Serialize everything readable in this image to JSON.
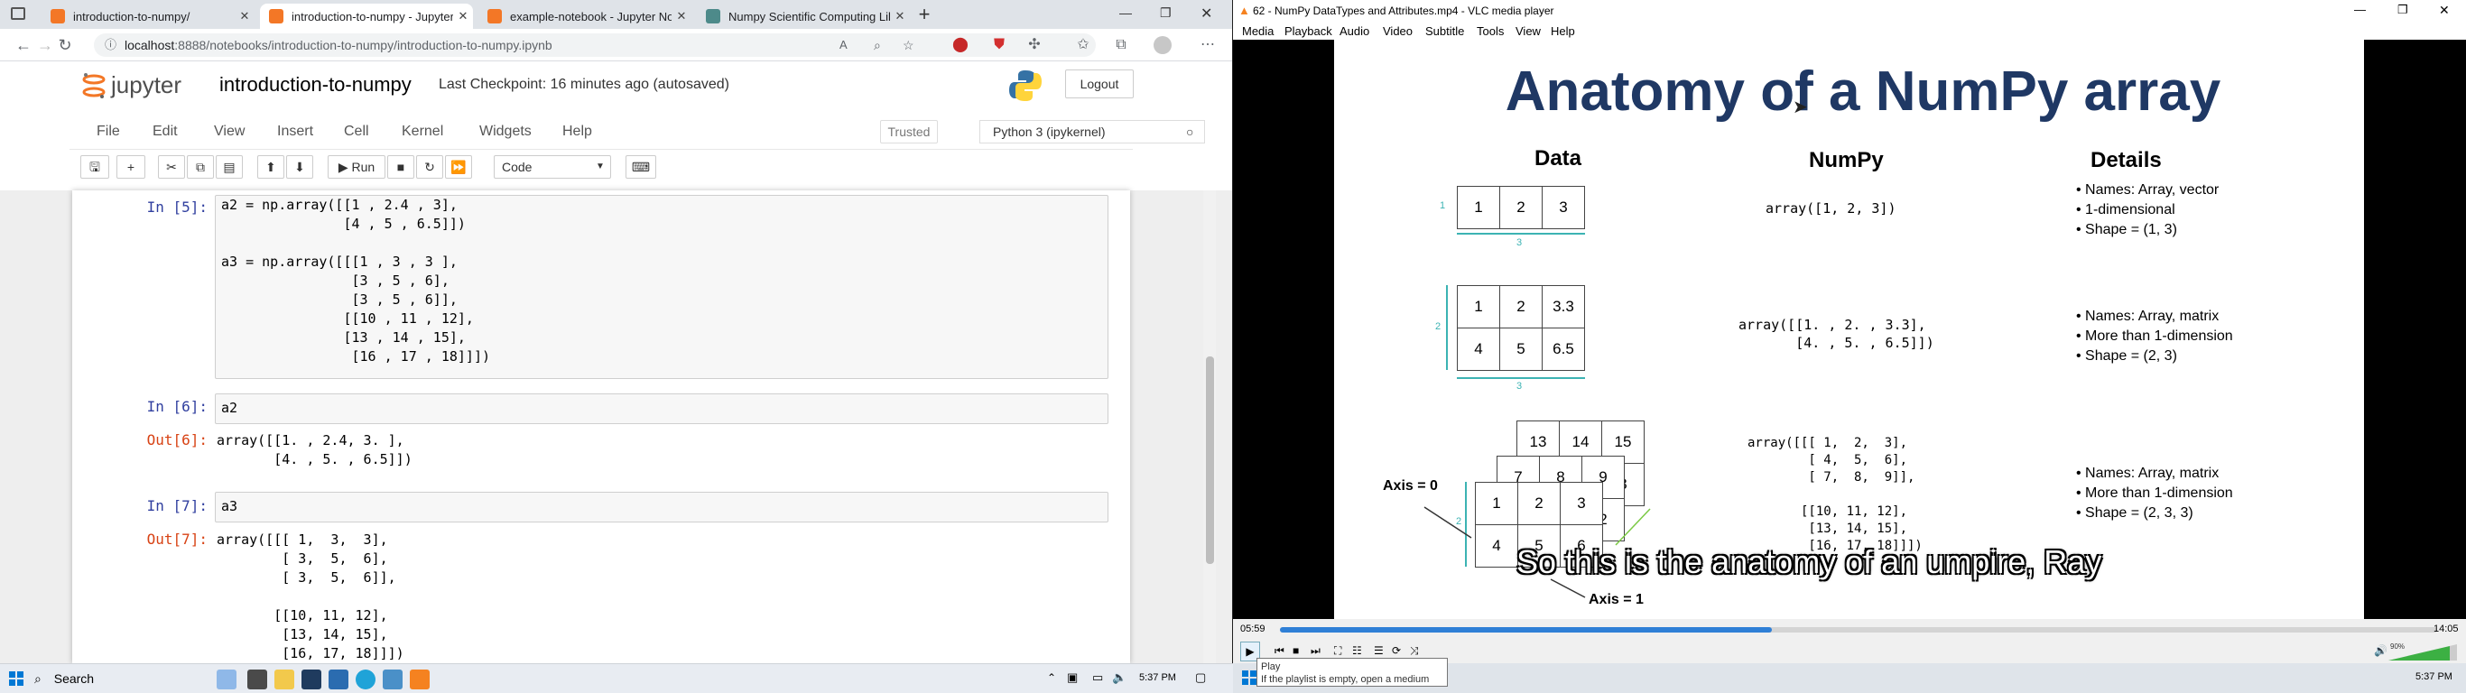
{
  "browser": {
    "tabs": [
      {
        "label": "introduction-to-numpy/",
        "active": false
      },
      {
        "label": "introduction-to-numpy - Jupyter Not",
        "active": true
      },
      {
        "label": "example-notebook - Jupyter Note",
        "active": false
      },
      {
        "label": "Numpy Scientific Computing Lib",
        "active": false
      }
    ],
    "new_tab": "+",
    "url_host": "localhost",
    "url_rest": ":8888/notebooks/introduction-to-numpy/introduction-to-numpy.ipynb"
  },
  "jupyter": {
    "logo_text": "jupyter",
    "notebook_title": "introduction-to-numpy",
    "checkpoint": "Last Checkpoint: 16 minutes ago  (autosaved)",
    "logout": "Logout",
    "menu": [
      "File",
      "Edit",
      "View",
      "Insert",
      "Cell",
      "Kernel",
      "Widgets",
      "Help"
    ],
    "trusted": "Trusted",
    "kernel": "Python 3 (ipykernel)",
    "run_label": "Run",
    "cell_type": "Code",
    "cells": [
      {
        "prompt": "In [5]:",
        "lines": [
          "a2 = np.array([[1 , 2.4 , 3],",
          "               [4 , 5 , 6.5]])",
          "",
          "a3 = np.array([[[1 , 3 , 3 ],",
          "                [3 , 5 , 6],",
          "                [3 , 5 , 6]],",
          "               [[10 , 11 , 12],",
          "               [13 , 14 , 15],",
          "                [16 , 17 , 18]]])"
        ]
      },
      {
        "prompt": "In [6]:",
        "lines": [
          "a2"
        ]
      },
      {
        "out_prompt": "Out[6]:",
        "out_lines": [
          "array([[1. , 2.4, 3. ],",
          "       [4. , 5. , 6.5]])"
        ]
      },
      {
        "prompt": "In [7]:",
        "lines": [
          "a3"
        ]
      },
      {
        "out_prompt": "Out[7]:",
        "out_lines": [
          "array([[[ 1,  3,  3],",
          "        [ 3,  5,  6],",
          "        [ 3,  5,  6]],",
          "",
          "       [[10, 11, 12],",
          "        [13, 14, 15],",
          "        [16, 17, 18]]])"
        ]
      }
    ]
  },
  "vlc": {
    "window_title": "62 - NumPy DataTypes and Attributes.mp4 - VLC media player",
    "menu": [
      "Media",
      "Playback",
      "Audio",
      "Video",
      "Subtitle",
      "Tools",
      "View",
      "Help"
    ],
    "slide": {
      "title": "Anatomy of a NumPy array",
      "col_data": "Data",
      "col_numpy": "NumPy",
      "col_details": "Details",
      "row1_code": "array([1, 2, 3])",
      "row1_details": [
        "Names: Array, vector",
        "1-dimensional",
        "Shape = (1, 3)"
      ],
      "row1_cells": [
        "1",
        "2",
        "3"
      ],
      "row1_dim_left": "1",
      "row1_dim_bottom": "3",
      "row2_code": "array([[1. , 2. , 3.3],\n       [4. , 5. , 6.5]])",
      "row2_details": [
        "Names: Array, matrix",
        "More than 1-dimension",
        "Shape = (2, 3)"
      ],
      "row2_cells": [
        "1",
        "2",
        "3.3",
        "4",
        "5",
        "6.5"
      ],
      "row2_dim_left": "2",
      "row2_dim_bottom": "3",
      "row3_code": "array([[[ 1,  2,  3],\n        [ 4,  5,  6],\n        [ 7,  8,  9]],\n\n       [[10, 11, 12],\n        [13, 14, 15],\n        [16, 17, 18]]])",
      "row3_details": [
        "Names: Array, matrix",
        "More than 1-dimension",
        "Shape = (2, 3, 3)"
      ],
      "row3_back": [
        "13",
        "14",
        "15"
      ],
      "row3_mid": [
        "7",
        "8",
        "9"
      ],
      "row3_front": [
        "1",
        "2",
        "3",
        "4",
        "5",
        "6"
      ],
      "row3_dim_left": "2",
      "row3_edge_digits": [
        "3",
        "2"
      ],
      "axis0": "Axis = 0",
      "axis1": "Axis = 1"
    },
    "subtitle": "So this is the anatomy of an umpire, Ray",
    "time_current": "05:59",
    "time_total": "14:05",
    "progress": 0.425,
    "volume": "90%",
    "tooltip_title": "Play",
    "tooltip_text": "If the playlist is empty, open a medium"
  },
  "taskbar": {
    "search": "Search",
    "clock_left": "5:37 PM",
    "clock_right": "5:37 PM"
  },
  "colors": {
    "jupyter_orange": "#f37726",
    "prompt_in": "#303f9f",
    "prompt_out": "#d84315",
    "slide_title": "#1f3864",
    "teal_dim": "#3cb3b3",
    "vlc_progress": "#2f7fd6"
  }
}
